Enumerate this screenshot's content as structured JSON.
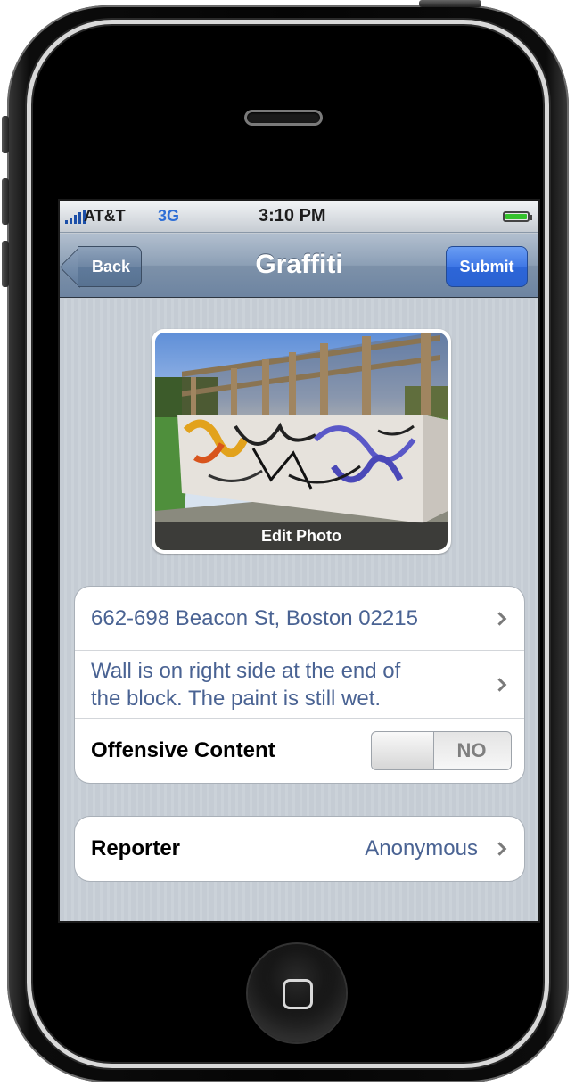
{
  "status_bar": {
    "carrier": "AT&T",
    "network": "3G",
    "time": "3:10 PM",
    "battery_level": 1.0
  },
  "nav": {
    "back_label": "Back",
    "title": "Graffiti",
    "submit_label": "Submit"
  },
  "photo": {
    "edit_label": "Edit Photo"
  },
  "details": {
    "address": "662-698 Beacon St, Boston 02215",
    "description_line1": "Wall is on right side at the end of",
    "description_line2": "the block.  The paint is still wet.",
    "offensive_label": "Offensive Content",
    "offensive_value": "NO"
  },
  "reporter": {
    "label": "Reporter",
    "value": "Anonymous"
  },
  "colors": {
    "nav_bar": "#7d91a9",
    "submit_button": "#3f78e6",
    "detail_text": "#4a6393",
    "battery": "#35c22c"
  },
  "icons": [
    "signal-bars-icon",
    "battery-icon",
    "back-arrow-icon",
    "chevron-right-icon",
    "home-square-icon"
  ]
}
